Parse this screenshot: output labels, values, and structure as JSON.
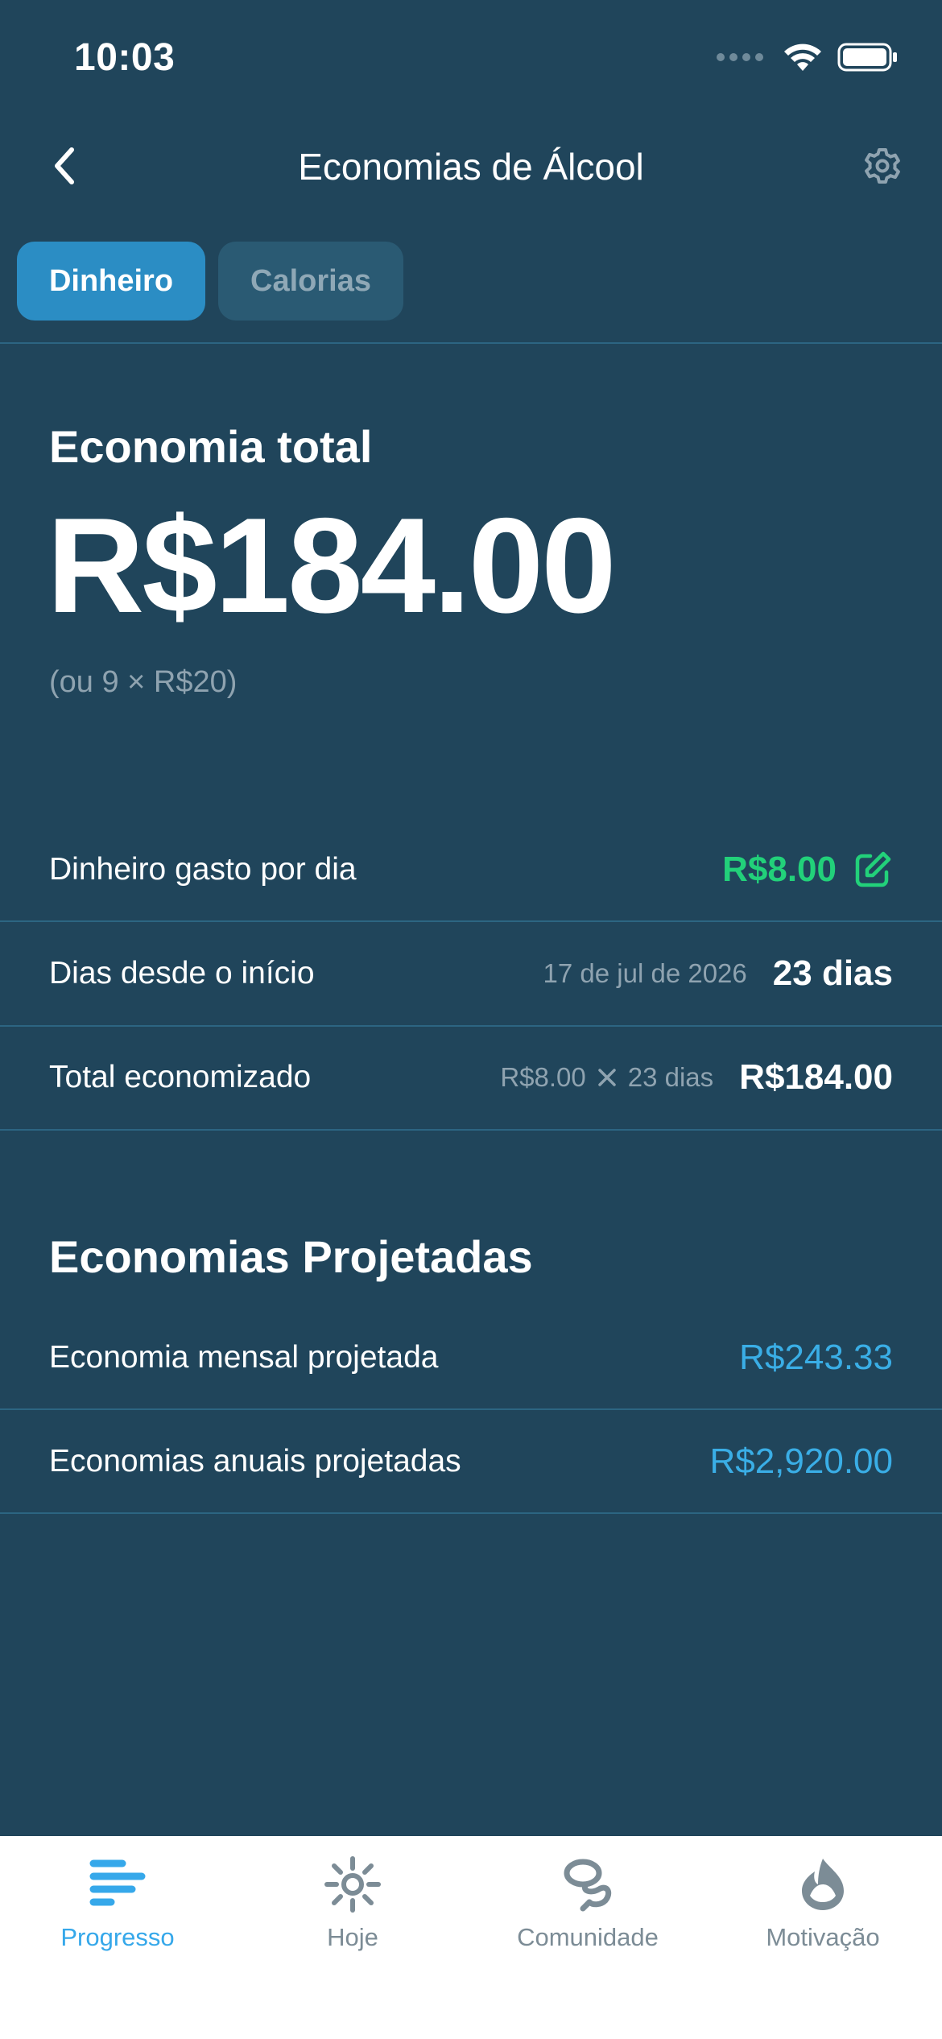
{
  "status_bar": {
    "time": "10:03"
  },
  "nav": {
    "title": "Economias de Álcool"
  },
  "segments": [
    {
      "label": "Dinheiro",
      "active": true
    },
    {
      "label": "Calorias",
      "active": false
    }
  ],
  "total": {
    "heading": "Economia total",
    "amount": "R$184.00",
    "equivalent": "(ou 9 × R$20)"
  },
  "details": {
    "spent_per_day": {
      "label": "Dinheiro gasto por dia",
      "value": "R$8.00"
    },
    "days_since_start": {
      "label": "Dias desde o início",
      "date": "17 de jul de 2026",
      "value": "23 dias"
    },
    "total_saved": {
      "label": "Total economizado",
      "formula_left": "R$8.00",
      "formula_right": "23 dias",
      "value": "R$184.00"
    }
  },
  "projected": {
    "heading": "Economias Projetadas",
    "monthly": {
      "label": "Economia mensal projetada",
      "value": "R$243.33"
    },
    "annual": {
      "label": "Economias anuais projetadas",
      "value": "R$2,920.00"
    }
  },
  "tab_bar": {
    "tabs": [
      {
        "label": "Progresso",
        "icon": "progress-icon",
        "active": true
      },
      {
        "label": "Hoje",
        "icon": "sun-icon",
        "active": false
      },
      {
        "label": "Comunidade",
        "icon": "community-icon",
        "active": false
      },
      {
        "label": "Motivação",
        "icon": "motivation-icon",
        "active": false
      }
    ]
  },
  "colors": {
    "background": "#20455b",
    "accent": "#2b8dc4",
    "green": "#22d17a",
    "blue_value": "#3aaee6",
    "tab_active": "#36a8ea"
  }
}
